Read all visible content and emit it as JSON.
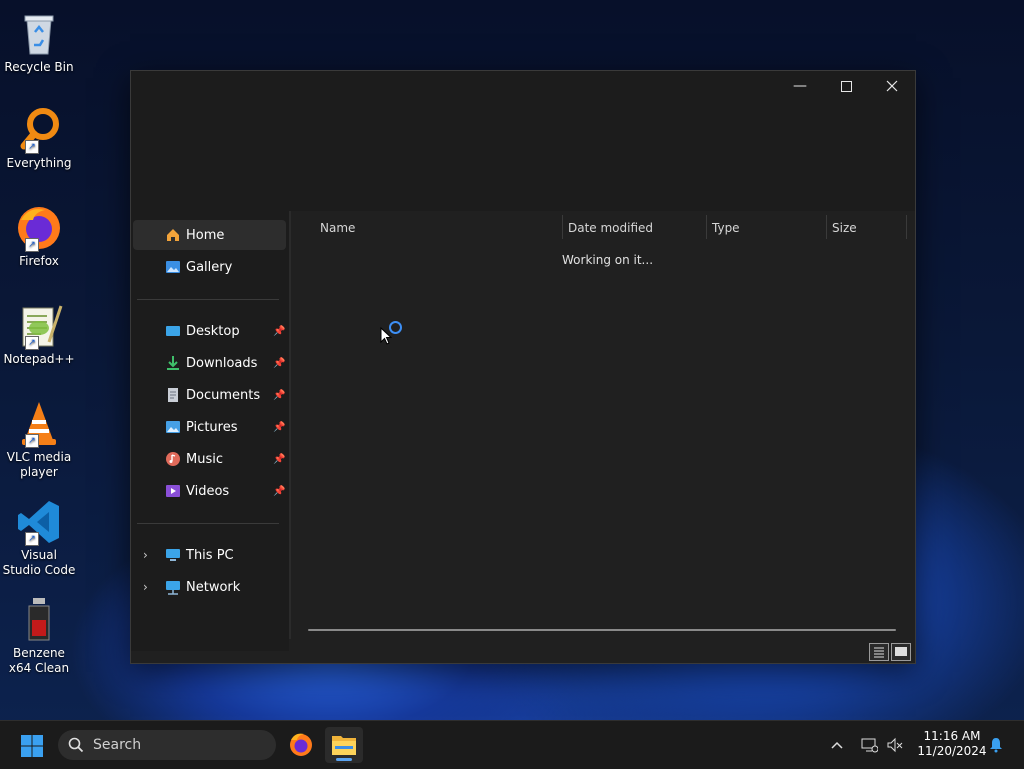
{
  "desktop": {
    "icons": [
      {
        "label": "Recycle Bin",
        "icon": "recycle-bin-icon"
      },
      {
        "label": "Everything",
        "icon": "everything-search-icon"
      },
      {
        "label": "Firefox",
        "icon": "firefox-icon"
      },
      {
        "label": "Notepad++",
        "icon": "notepad-plus-plus-icon"
      },
      {
        "label": "VLC media player",
        "icon": "vlc-icon"
      },
      {
        "label": "Visual Studio Code",
        "icon": "vscode-icon"
      },
      {
        "label": "Benzene x64 Clean",
        "icon": "benzene-icon"
      }
    ]
  },
  "explorer": {
    "nav": {
      "home": "Home",
      "gallery": "Gallery",
      "desktop": "Desktop",
      "downloads": "Downloads",
      "documents": "Documents",
      "pictures": "Pictures",
      "music": "Music",
      "videos": "Videos",
      "this_pc": "This PC",
      "network": "Network"
    },
    "columns": {
      "name": "Name",
      "date_modified": "Date modified",
      "type": "Type",
      "size": "Size"
    },
    "status": "Working on it..."
  },
  "taskbar": {
    "search_label": "Search",
    "time": "11:16 AM",
    "date": "11/20/2024"
  },
  "colors": {
    "accent": "#3d8ff5",
    "window_bg": "#202020",
    "taskbar_bg": "#1b1b1b"
  }
}
